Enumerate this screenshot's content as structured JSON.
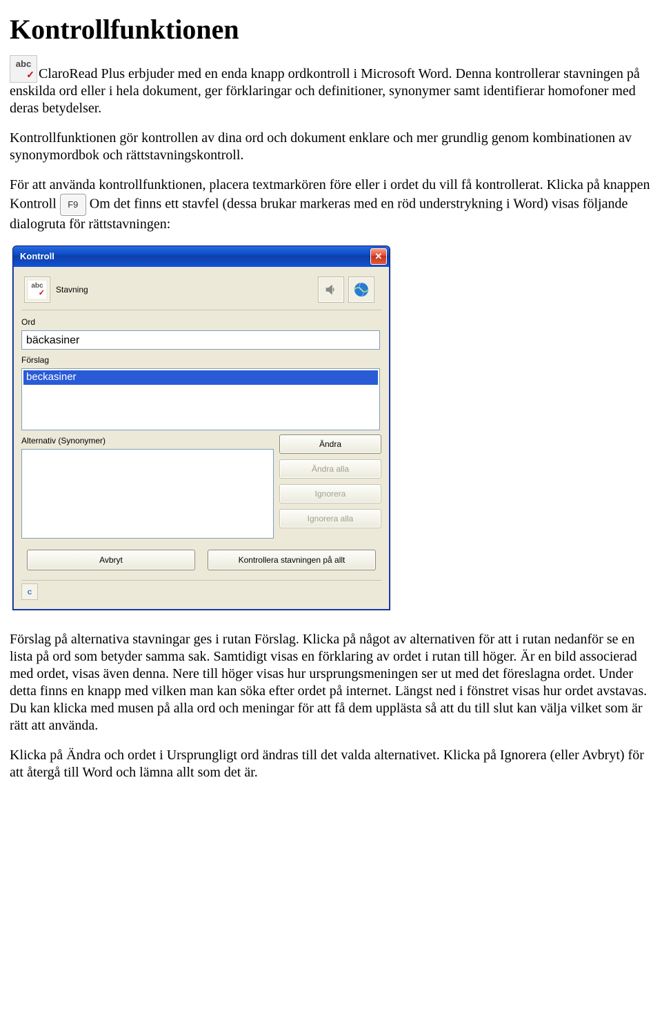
{
  "heading": "Kontrollfunktionen",
  "para1": "ClaroRead Plus erbjuder med en enda knapp ordkontroll i Microsoft Word. Denna kontrollerar stavningen på enskilda ord eller i hela dokument, ger förklaringar och definitioner, synonymer samt identifierar homofoner med deras betydelser.",
  "para2": "Kontrollfunktionen gör kontrollen av dina ord och dokument enklare och mer grundlig genom kombinationen av synonymordbok och rättstavningskontroll.",
  "para3_prefix": "För att använda kontrollfunktionen, placera textmarkören före eller i ordet du vill få kontrollerat. Klicka på knappen Kontroll ",
  "para3_suffix": "Om det finns ett stavfel (dessa brukar markeras med en röd understrykning i Word) visas följande dialogruta för rättstavningen:",
  "para4": "Förslag på alternativa stavningar ges i rutan Förslag. Klicka på något av alternativen för att i rutan nedanför se en lista på ord som betyder samma sak. Samtidigt visas en förklaring av ordet i rutan till höger. Är en bild associerad med ordet, visas även denna. Nere till höger visas hur ursprungsmeningen ser ut med det föreslagna ordet. Under detta finns en knapp med vilken man kan söka efter ordet på internet. Längst ned i fönstret visas hur ordet avstavas. Du kan klicka med musen på alla ord och meningar för att få dem upplästa så att du till slut kan välja vilket som är rätt att använda.",
  "para5": "Klicka på Ändra och ordet i Ursprungligt ord ändras till det valda alternativet. Klicka på Ignorera (eller Avbryt) för att återgå till Word och lämna allt som det är.",
  "dialog": {
    "title": "Kontroll",
    "tab_label": "Stavning",
    "ord_label": "Ord",
    "ord_value": "bäckasiner",
    "forslag_label": "Förslag",
    "forslag_selected": "beckasiner",
    "alt_label": "Alternativ (Synonymer)",
    "btn_andra": "Ändra",
    "btn_andra_alla": "Ändra alla",
    "btn_ignorera": "Ignorera",
    "btn_ignorera_alla": "Ignorera alla",
    "btn_avbryt": "Avbryt",
    "btn_kontrollera": "Kontrollera stavningen på allt",
    "status_char": "c"
  }
}
